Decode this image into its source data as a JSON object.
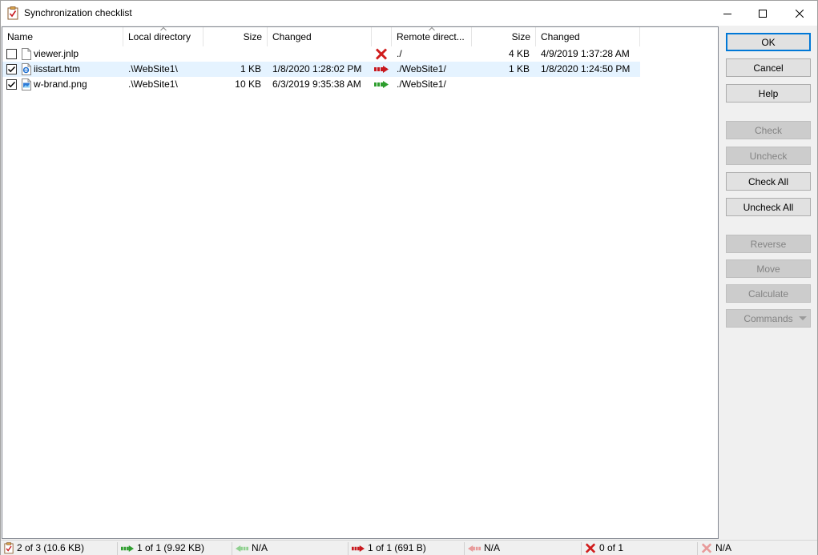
{
  "window": {
    "title": "Synchronization checklist"
  },
  "list": {
    "columns": {
      "name": "Name",
      "local_directory": "Local directory",
      "local_size": "Size",
      "local_changed": "Changed",
      "remote_directory": "Remote direct...",
      "remote_size": "Size",
      "remote_changed": "Changed"
    },
    "rows": [
      {
        "checked": false,
        "name": "viewer.jnlp",
        "file_icon": "file-icon",
        "local_directory": "",
        "local_size": "",
        "local_changed": "",
        "action_icon": "delete-icon",
        "remote_directory": "./",
        "remote_size": "4 KB",
        "remote_changed": "4/9/2019 1:37:28 AM"
      },
      {
        "checked": true,
        "name": "iisstart.htm",
        "file_icon": "html-file-icon",
        "local_directory": ".\\WebSite1\\",
        "local_size": "1 KB",
        "local_changed": "1/8/2020 1:28:02 PM",
        "action_icon": "upload-replace-icon",
        "remote_directory": "./WebSite1/",
        "remote_size": "1 KB",
        "remote_changed": "1/8/2020 1:24:50 PM"
      },
      {
        "checked": true,
        "name": "w-brand.png",
        "file_icon": "image-file-icon",
        "local_directory": ".\\WebSite1\\",
        "local_size": "10 KB",
        "local_changed": "6/3/2019 9:35:38 AM",
        "action_icon": "upload-new-icon",
        "remote_directory": "./WebSite1/",
        "remote_size": "",
        "remote_changed": ""
      }
    ]
  },
  "buttons": {
    "ok": "OK",
    "cancel": "Cancel",
    "help": "Help",
    "check": "Check",
    "uncheck": "Uncheck",
    "check_all": "Check All",
    "uncheck_all": "Uncheck All",
    "reverse": "Reverse",
    "move": "Move",
    "calculate": "Calculate",
    "commands": "Commands"
  },
  "status": {
    "selected": "2 of 3 (10.6 KB)",
    "upload_new": "1 of 1 (9.92 KB)",
    "download_new": "N/A",
    "upload_replace": "1 of 1 (691 B)",
    "download_replace": "N/A",
    "delete_remote": "0 of 1",
    "delete_local": "N/A"
  },
  "colors": {
    "selection": "#e5f3ff",
    "default_button_border": "#0078d7",
    "green_arrow": "#2e9e2e",
    "red_arrow": "#c8181e",
    "delete_x": "#d01c1c"
  }
}
